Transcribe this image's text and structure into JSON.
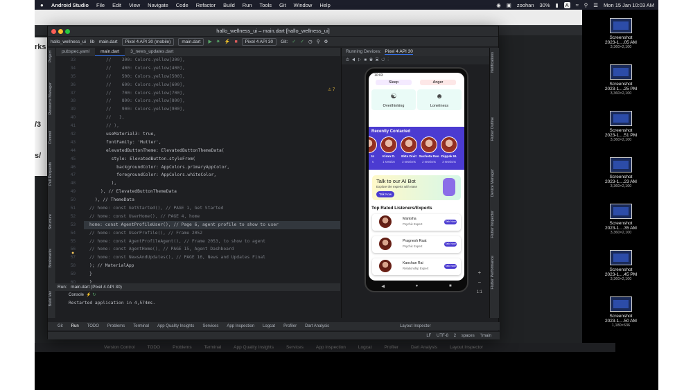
{
  "menubar": {
    "app": "Android Studio",
    "items": [
      "File",
      "Edit",
      "View",
      "Navigate",
      "Code",
      "Refactor",
      "Build",
      "Run",
      "Tools",
      "Git",
      "Window",
      "Help"
    ],
    "user": "zoohan",
    "battery": "30%",
    "input_indicator": "A",
    "clock": "Mon 15 Jan  10:03 AM"
  },
  "back_window": {
    "title": "implicit_animation_flutter – main.dart [implicit_animation_flutter]",
    "bottom_tabs": [
      "Version Control",
      "TODO",
      "Problems",
      "Terminal",
      "App Quality Insights",
      "Services",
      "App Inspection",
      "Logcat",
      "Profiler",
      "Dart Analysis",
      "Layout Inspector"
    ]
  },
  "left_peek": [
    "rks",
    "/3",
    "s/"
  ],
  "ide": {
    "title": "hallo_wellness_ui – main.dart [hallo_wellness_ui]",
    "toolbar": {
      "project": "hallo_wellness_ui",
      "lib": "lib",
      "file": "main.dart",
      "device": "Pixel 4 API 30 (mobile)",
      "run_config": "main.dart",
      "emulator": "Pixel 4 API 30",
      "git": "Git:"
    },
    "tabs": [
      "pubspec.yaml",
      "main.dart",
      "3_news_updates.dart"
    ],
    "warnings": "7",
    "left_tools": [
      "Project",
      "Resource Manager",
      "Commit",
      "Pull Requests",
      "Structure",
      "Bookmarks",
      "Build Variants"
    ],
    "right_tools": [
      "Notifications",
      "Flutter Outline",
      "Device Manager",
      "Flutter Inspector",
      "Flutter Performance",
      "Flutter Outline"
    ],
    "line_numbers": [
      "33",
      "34",
      "35",
      "36",
      "37",
      "38",
      "39",
      "40",
      "41",
      "42",
      "43",
      "44",
      "45",
      "46",
      "47",
      "48",
      "49",
      "50",
      "51",
      "52",
      "53",
      "54",
      "55",
      "56",
      "57",
      "58",
      "59",
      "60"
    ],
    "code_lines": [
      {
        "t": "//    300: Colors.yellow[300],",
        "c": "cm"
      },
      {
        "t": "//    400: Colors.yellow[400],",
        "c": "cm"
      },
      {
        "t": "//    500: Colors.yellow[500],",
        "c": "cm"
      },
      {
        "t": "//    600: Colors.yellow[600],",
        "c": "cm"
      },
      {
        "t": "//    700: Colors.yellow[700],",
        "c": "cm"
      },
      {
        "t": "//    800: Colors.yellow[800],",
        "c": "cm"
      },
      {
        "t": "//    900: Colors.yellow[900],",
        "c": "cm"
      },
      {
        "t": "//   },",
        "c": "cm"
      },
      {
        "t": "// ),",
        "c": "cm"
      },
      {
        "t": "useMaterial3: true,",
        "c": ""
      },
      {
        "t": "fontFamily: 'Mutter',",
        "c": ""
      },
      {
        "t": "elevatedButtonTheme: ElevatedButtonThemeData(",
        "c": ""
      },
      {
        "t": "  style: ElevatedButton.styleFrom(",
        "c": ""
      },
      {
        "t": "    backgroundColor: AppColors.primaryAppColor,",
        "c": ""
      },
      {
        "t": "    foregroundColor: AppColors.whiteColor,",
        "c": ""
      },
      {
        "t": "  ),",
        "c": ""
      },
      {
        "t": "), // ElevatedButtonThemeData",
        "c": ""
      },
      {
        "t": "), // ThemeData",
        "c": ""
      },
      {
        "t": "// home: const GetStarted(), // PAGE 1, Get Started",
        "c": "cm"
      },
      {
        "t": "// home: const UserHome(), // PAGE 4, home",
        "c": "cm"
      },
      {
        "t": "home: const AgentProfileUser(), // Page 6, agent profile to show to user",
        "c": "hl"
      },
      {
        "t": "// home: const UserProfile(), // Frame 2052",
        "c": "cm"
      },
      {
        "t": "// home: const AgentProfileAgent(), // Frame 2053, to show to agent",
        "c": "cm"
      },
      {
        "t": "// home: const AgentHome(), // PAGE 15, Agent Dashboard",
        "c": "cm"
      },
      {
        "t": "// home: const NewsAndUpdates(), // PAGE 16, News and Updates Final",
        "c": "cm"
      },
      {
        "t": "); // MaterialApp",
        "c": ""
      },
      {
        "t": "}",
        "c": ""
      },
      {
        "t": "}",
        "c": ""
      }
    ],
    "device_panel": {
      "header": "Running Devices:",
      "device_tab": "Pixel 4 API 30"
    },
    "run_bar": {
      "label": "Run:",
      "config": "main.dart (Pixel 4 API 30)"
    },
    "console_tab": "Console",
    "console_output": "Restarted application in 4,574ms.",
    "tool_windows": [
      "Git",
      "Run",
      "TODO",
      "Problems",
      "Terminal",
      "App Quality Insights",
      "Services",
      "App Inspection",
      "Logcat",
      "Profiler",
      "Dart Analysis",
      "Layout Inspector"
    ],
    "status": {
      "lf": "LF",
      "encoding": "UTF-8",
      "indent": "2 spaces",
      "branch": "main"
    }
  },
  "phone": {
    "time": "10:03",
    "top_pills": [
      "Sleep",
      "Anger"
    ],
    "cards": [
      "Overthinking",
      "Loneliness"
    ],
    "recently_contacted_title": "Recently Contacted",
    "contacts": [
      {
        "name": "In",
        "sessions": "s"
      },
      {
        "name": "Kiran D.",
        "sessions": "1 session"
      },
      {
        "name": "Ekta Dixit",
        "sessions": "3 sessions"
      },
      {
        "name": "Sucheta Rao",
        "sessions": "2 sessions"
      },
      {
        "name": "Dippak M.",
        "sessions": "3 sessions"
      }
    ],
    "ai_bot": {
      "title": "Talk to our AI Bot",
      "subtitle": "Explore the experts with ease",
      "button": "Talk Now"
    },
    "top_rated_title": "Top Rated Listeners/Experts",
    "listeners": [
      {
        "name": "Manisha",
        "role": "Psychic Expert",
        "rating": "4.9",
        "button": "Talk Now"
      },
      {
        "name": "Pragnesh Raat",
        "role": "Psychic Expert",
        "rating": "4.9",
        "button": "Talk Now"
      },
      {
        "name": "Kanchan Rai",
        "role": "Relationship Expert",
        "rating": "4.9",
        "button": "Talk Now"
      }
    ],
    "zoom_controls": [
      "+",
      "−",
      "1:1"
    ]
  },
  "desktop_screenshots": [
    {
      "line1": "Screenshot",
      "line2": "2023-1....05 AM",
      "size": "3,360×2,100"
    },
    {
      "line1": "Screenshot",
      "line2": "2023-1....25 PM",
      "size": "3,360×2,100"
    },
    {
      "line1": "Screenshot",
      "line2": "2023-1....51 PM",
      "size": "3,360×2,100"
    },
    {
      "line1": "Screenshot",
      "line2": "2023-1....23 AM",
      "size": "3,360×2,100"
    },
    {
      "line1": "Screenshot",
      "line2": "2023-1....35 AM",
      "size": "3,360×2,100"
    },
    {
      "line1": "Screenshot",
      "line2": "2023-1....45 PM",
      "size": "3,360×2,100"
    },
    {
      "line1": "Screenshot",
      "line2": "2023-1....50 AM",
      "size": "1,180×636"
    }
  ]
}
